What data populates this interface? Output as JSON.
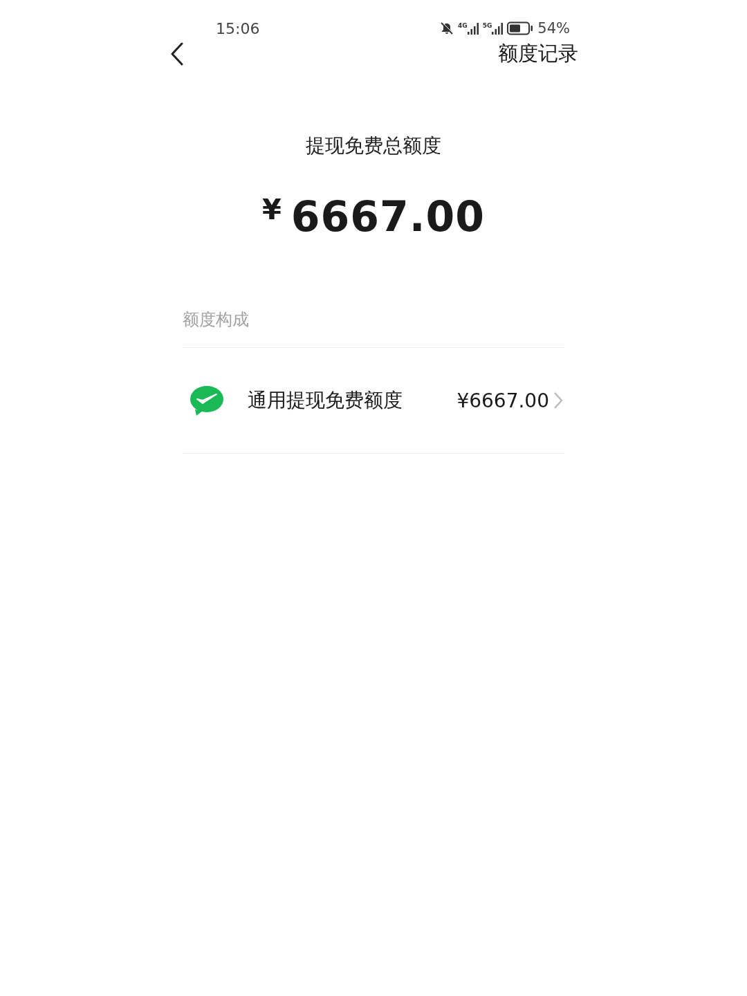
{
  "status_bar": {
    "time": "15:06",
    "networks": [
      "4G",
      "5G"
    ],
    "battery": "54%"
  },
  "nav": {
    "action": "额度记录"
  },
  "summary": {
    "title": "提现免费总额度",
    "currency": "¥",
    "amount": "6667.00"
  },
  "section": {
    "title": "额度构成"
  },
  "items": [
    {
      "label": "通用提现免费额度",
      "amount": "¥6667.00"
    }
  ]
}
